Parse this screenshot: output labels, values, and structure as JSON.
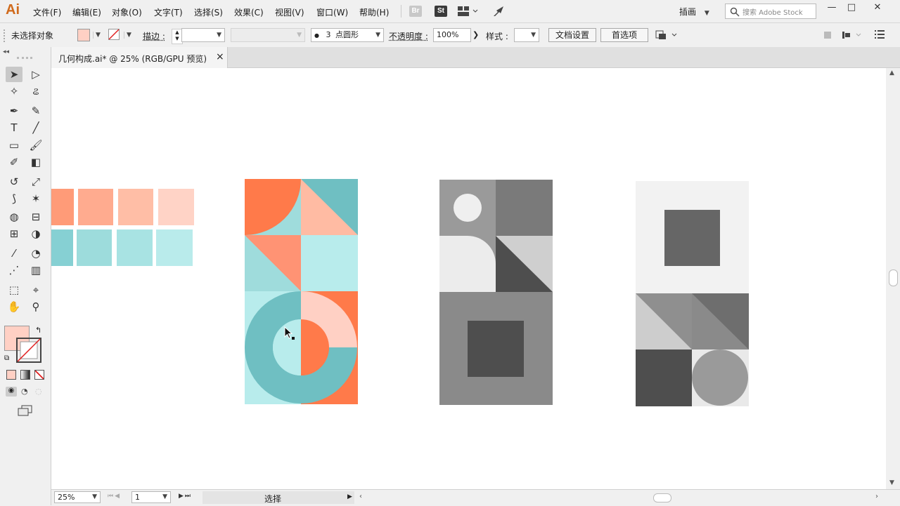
{
  "app": {
    "logo": "Ai"
  },
  "menus": [
    "文件(F)",
    "编辑(E)",
    "对象(O)",
    "文字(T)",
    "选择(S)",
    "效果(C)",
    "视图(V)",
    "窗口(W)",
    "帮助(H)"
  ],
  "menu_buttons": {
    "bridge": "Br",
    "stock": "St"
  },
  "workspace": {
    "label": "插画"
  },
  "search": {
    "placeholder": "搜索 Adobe Stock"
  },
  "window_controls": {
    "minimize": "—",
    "restore": "□",
    "close": "✕"
  },
  "control_bar": {
    "selection_status": "未选择对象",
    "stroke_label": "描边 :",
    "brush_size": "3",
    "brush_label": "点圆形",
    "opacity_label": "不透明度 :",
    "opacity_value": "100%",
    "style_label": "样式 :",
    "doc_setup": "文档设置",
    "preferences": "首选项"
  },
  "document_tab": {
    "title": "几何构成.ai* @ 25% (RGB/GPU 预览)",
    "close": "×"
  },
  "status_bar": {
    "zoom": "25%",
    "page": "1",
    "tool": "选择"
  },
  "colors": {
    "fill": "#ffd0c4",
    "coral": "#ff7a4a",
    "salmon": "#ff9374",
    "peach": "#ffbba3",
    "teal": "#6fbfc2",
    "aqua": "#9fdcdc",
    "pale_aqua": "#b8ecec",
    "swatches_top": [
      "#ff9b78",
      "#ffab8f",
      "#ffbea6",
      "#ffd3c6"
    ],
    "swatches_bottom": [
      "#86d0d3",
      "#9ddcdc",
      "#a8e3e3",
      "#b9ebeb"
    ]
  },
  "icons": [
    "selection-tool-icon",
    "direct-selection-icon",
    "magic-wand-icon",
    "lasso-icon",
    "pen-icon",
    "curvature-icon",
    "type-icon",
    "line-icon",
    "rectangle-icon",
    "paintbrush-icon",
    "shaper-icon",
    "eraser-icon",
    "rotate-icon",
    "scale-icon",
    "width-icon",
    "pin-icon",
    "shape-builder-icon",
    "perspective-icon",
    "mesh-icon",
    "gradient-icon",
    "eyedropper-icon",
    "blend-icon",
    "symbol-sprayer-icon",
    "graph-icon",
    "artboard-icon",
    "slice-icon",
    "hand-icon",
    "zoom-icon"
  ]
}
